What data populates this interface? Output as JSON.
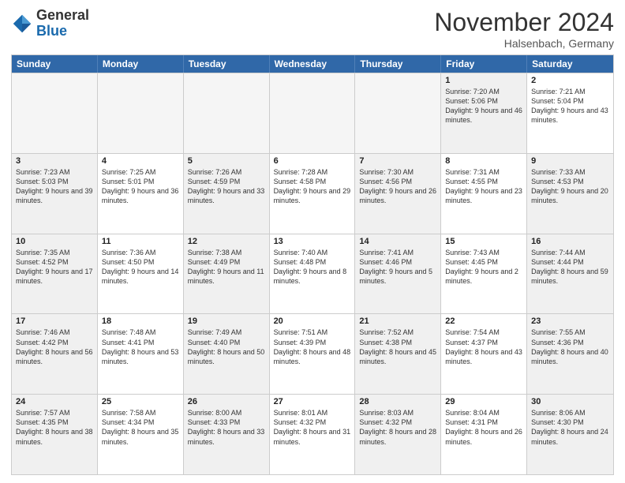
{
  "logo": {
    "general": "General",
    "blue": "Blue"
  },
  "header": {
    "month": "November 2024",
    "location": "Halsenbach, Germany"
  },
  "weekdays": [
    "Sunday",
    "Monday",
    "Tuesday",
    "Wednesday",
    "Thursday",
    "Friday",
    "Saturday"
  ],
  "rows": [
    [
      {
        "day": "",
        "info": "",
        "empty": true
      },
      {
        "day": "",
        "info": "",
        "empty": true
      },
      {
        "day": "",
        "info": "",
        "empty": true
      },
      {
        "day": "",
        "info": "",
        "empty": true
      },
      {
        "day": "",
        "info": "",
        "empty": true
      },
      {
        "day": "1",
        "info": "Sunrise: 7:20 AM\nSunset: 5:06 PM\nDaylight: 9 hours and 46 minutes.",
        "shaded": true
      },
      {
        "day": "2",
        "info": "Sunrise: 7:21 AM\nSunset: 5:04 PM\nDaylight: 9 hours and 43 minutes.",
        "shaded": false
      }
    ],
    [
      {
        "day": "3",
        "info": "Sunrise: 7:23 AM\nSunset: 5:03 PM\nDaylight: 9 hours and 39 minutes.",
        "shaded": true
      },
      {
        "day": "4",
        "info": "Sunrise: 7:25 AM\nSunset: 5:01 PM\nDaylight: 9 hours and 36 minutes.",
        "shaded": false
      },
      {
        "day": "5",
        "info": "Sunrise: 7:26 AM\nSunset: 4:59 PM\nDaylight: 9 hours and 33 minutes.",
        "shaded": true
      },
      {
        "day": "6",
        "info": "Sunrise: 7:28 AM\nSunset: 4:58 PM\nDaylight: 9 hours and 29 minutes.",
        "shaded": false
      },
      {
        "day": "7",
        "info": "Sunrise: 7:30 AM\nSunset: 4:56 PM\nDaylight: 9 hours and 26 minutes.",
        "shaded": true
      },
      {
        "day": "8",
        "info": "Sunrise: 7:31 AM\nSunset: 4:55 PM\nDaylight: 9 hours and 23 minutes.",
        "shaded": false
      },
      {
        "day": "9",
        "info": "Sunrise: 7:33 AM\nSunset: 4:53 PM\nDaylight: 9 hours and 20 minutes.",
        "shaded": true
      }
    ],
    [
      {
        "day": "10",
        "info": "Sunrise: 7:35 AM\nSunset: 4:52 PM\nDaylight: 9 hours and 17 minutes.",
        "shaded": true
      },
      {
        "day": "11",
        "info": "Sunrise: 7:36 AM\nSunset: 4:50 PM\nDaylight: 9 hours and 14 minutes.",
        "shaded": false
      },
      {
        "day": "12",
        "info": "Sunrise: 7:38 AM\nSunset: 4:49 PM\nDaylight: 9 hours and 11 minutes.",
        "shaded": true
      },
      {
        "day": "13",
        "info": "Sunrise: 7:40 AM\nSunset: 4:48 PM\nDaylight: 9 hours and 8 minutes.",
        "shaded": false
      },
      {
        "day": "14",
        "info": "Sunrise: 7:41 AM\nSunset: 4:46 PM\nDaylight: 9 hours and 5 minutes.",
        "shaded": true
      },
      {
        "day": "15",
        "info": "Sunrise: 7:43 AM\nSunset: 4:45 PM\nDaylight: 9 hours and 2 minutes.",
        "shaded": false
      },
      {
        "day": "16",
        "info": "Sunrise: 7:44 AM\nSunset: 4:44 PM\nDaylight: 8 hours and 59 minutes.",
        "shaded": true
      }
    ],
    [
      {
        "day": "17",
        "info": "Sunrise: 7:46 AM\nSunset: 4:42 PM\nDaylight: 8 hours and 56 minutes.",
        "shaded": true
      },
      {
        "day": "18",
        "info": "Sunrise: 7:48 AM\nSunset: 4:41 PM\nDaylight: 8 hours and 53 minutes.",
        "shaded": false
      },
      {
        "day": "19",
        "info": "Sunrise: 7:49 AM\nSunset: 4:40 PM\nDaylight: 8 hours and 50 minutes.",
        "shaded": true
      },
      {
        "day": "20",
        "info": "Sunrise: 7:51 AM\nSunset: 4:39 PM\nDaylight: 8 hours and 48 minutes.",
        "shaded": false
      },
      {
        "day": "21",
        "info": "Sunrise: 7:52 AM\nSunset: 4:38 PM\nDaylight: 8 hours and 45 minutes.",
        "shaded": true
      },
      {
        "day": "22",
        "info": "Sunrise: 7:54 AM\nSunset: 4:37 PM\nDaylight: 8 hours and 43 minutes.",
        "shaded": false
      },
      {
        "day": "23",
        "info": "Sunrise: 7:55 AM\nSunset: 4:36 PM\nDaylight: 8 hours and 40 minutes.",
        "shaded": true
      }
    ],
    [
      {
        "day": "24",
        "info": "Sunrise: 7:57 AM\nSunset: 4:35 PM\nDaylight: 8 hours and 38 minutes.",
        "shaded": true
      },
      {
        "day": "25",
        "info": "Sunrise: 7:58 AM\nSunset: 4:34 PM\nDaylight: 8 hours and 35 minutes.",
        "shaded": false
      },
      {
        "day": "26",
        "info": "Sunrise: 8:00 AM\nSunset: 4:33 PM\nDaylight: 8 hours and 33 minutes.",
        "shaded": true
      },
      {
        "day": "27",
        "info": "Sunrise: 8:01 AM\nSunset: 4:32 PM\nDaylight: 8 hours and 31 minutes.",
        "shaded": false
      },
      {
        "day": "28",
        "info": "Sunrise: 8:03 AM\nSunset: 4:32 PM\nDaylight: 8 hours and 28 minutes.",
        "shaded": true
      },
      {
        "day": "29",
        "info": "Sunrise: 8:04 AM\nSunset: 4:31 PM\nDaylight: 8 hours and 26 minutes.",
        "shaded": false
      },
      {
        "day": "30",
        "info": "Sunrise: 8:06 AM\nSunset: 4:30 PM\nDaylight: 8 hours and 24 minutes.",
        "shaded": true
      }
    ]
  ]
}
